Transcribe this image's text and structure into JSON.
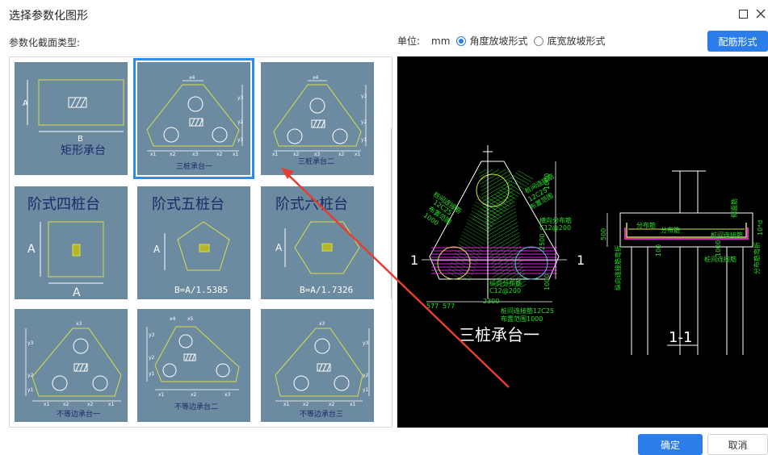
{
  "window": {
    "title": "选择参数化图形"
  },
  "labels": {
    "section_type": "参数化截面类型:",
    "unit_label": "单位:",
    "unit_value": "mm"
  },
  "radios": [
    {
      "label": "角度放坡形式",
      "selected": true
    },
    {
      "label": "底宽放坡形式",
      "selected": false
    }
  ],
  "buttons": {
    "rebar": "配筋形式",
    "ok": "确定",
    "cancel": "取消"
  },
  "thumbnails": [
    {
      "name": "矩形承台",
      "labels": [
        "A",
        "B"
      ]
    },
    {
      "name": "三桩承台一",
      "labels": [
        "x4",
        "y3",
        "y2",
        "y1",
        "x1",
        "x2",
        "x3",
        "x2",
        "x1"
      ]
    },
    {
      "name": "三桩承台二",
      "labels": [
        "x4",
        "y3",
        "y2",
        "y1",
        "x1",
        "x2",
        "x3",
        "x2",
        "x1"
      ]
    },
    {
      "name": "阶式四桩台",
      "labels": [
        "A",
        "A"
      ]
    },
    {
      "name": "阶式五桩台",
      "labels": [
        "A",
        "B=A/1.5385"
      ]
    },
    {
      "name": "阶式六桩台",
      "labels": [
        "A",
        "B=A/1.7326"
      ]
    },
    {
      "name": "不等边承台一",
      "labels": [
        "x3",
        "y3",
        "y2",
        "y1",
        "x1",
        "x2",
        "x2",
        "x1"
      ]
    },
    {
      "name": "不等边承台二",
      "labels": [
        "x4",
        "x5",
        "y3",
        "y2",
        "y1",
        "x1",
        "x2",
        "x3"
      ]
    },
    {
      "name": "不等边承台三",
      "labels": [
        "x3",
        "y3",
        "y2",
        "y1",
        "x1",
        "x2",
        "x2",
        "x1"
      ]
    }
  ],
  "preview": {
    "title_main": "三桩承台一",
    "title_section": "1-1",
    "section_marks": [
      "1",
      "1"
    ],
    "labels_main": [
      "桩间连接筋",
      "12C25",
      "布置范围",
      "1000",
      "桩间连接筋",
      "12C25",
      "布置范围",
      "横向分布筋",
      "C12@200",
      "纵向分布筋",
      "C12@200",
      "桩间连接筋12C25",
      "布置范围1000",
      "2500",
      "1000",
      "1000",
      "577",
      "577",
      "2300"
    ],
    "labels_section": [
      "分布筋",
      "分布筋",
      "桩间连接筋",
      "桩间连接筋",
      "侧面筋",
      "500",
      "100",
      "1000",
      "纵向连接筋弯折",
      "分布筋弯折",
      "10*d"
    ]
  },
  "colors": {
    "accent": "#2b7de9",
    "thumb_bg": "#6c8aa0",
    "selected_border": "#2d8cf0",
    "cad_yellow": "#d8e04a",
    "cad_green": "#24e024",
    "cad_magenta": "#e020e0",
    "arrow_red": "#e53e30"
  }
}
